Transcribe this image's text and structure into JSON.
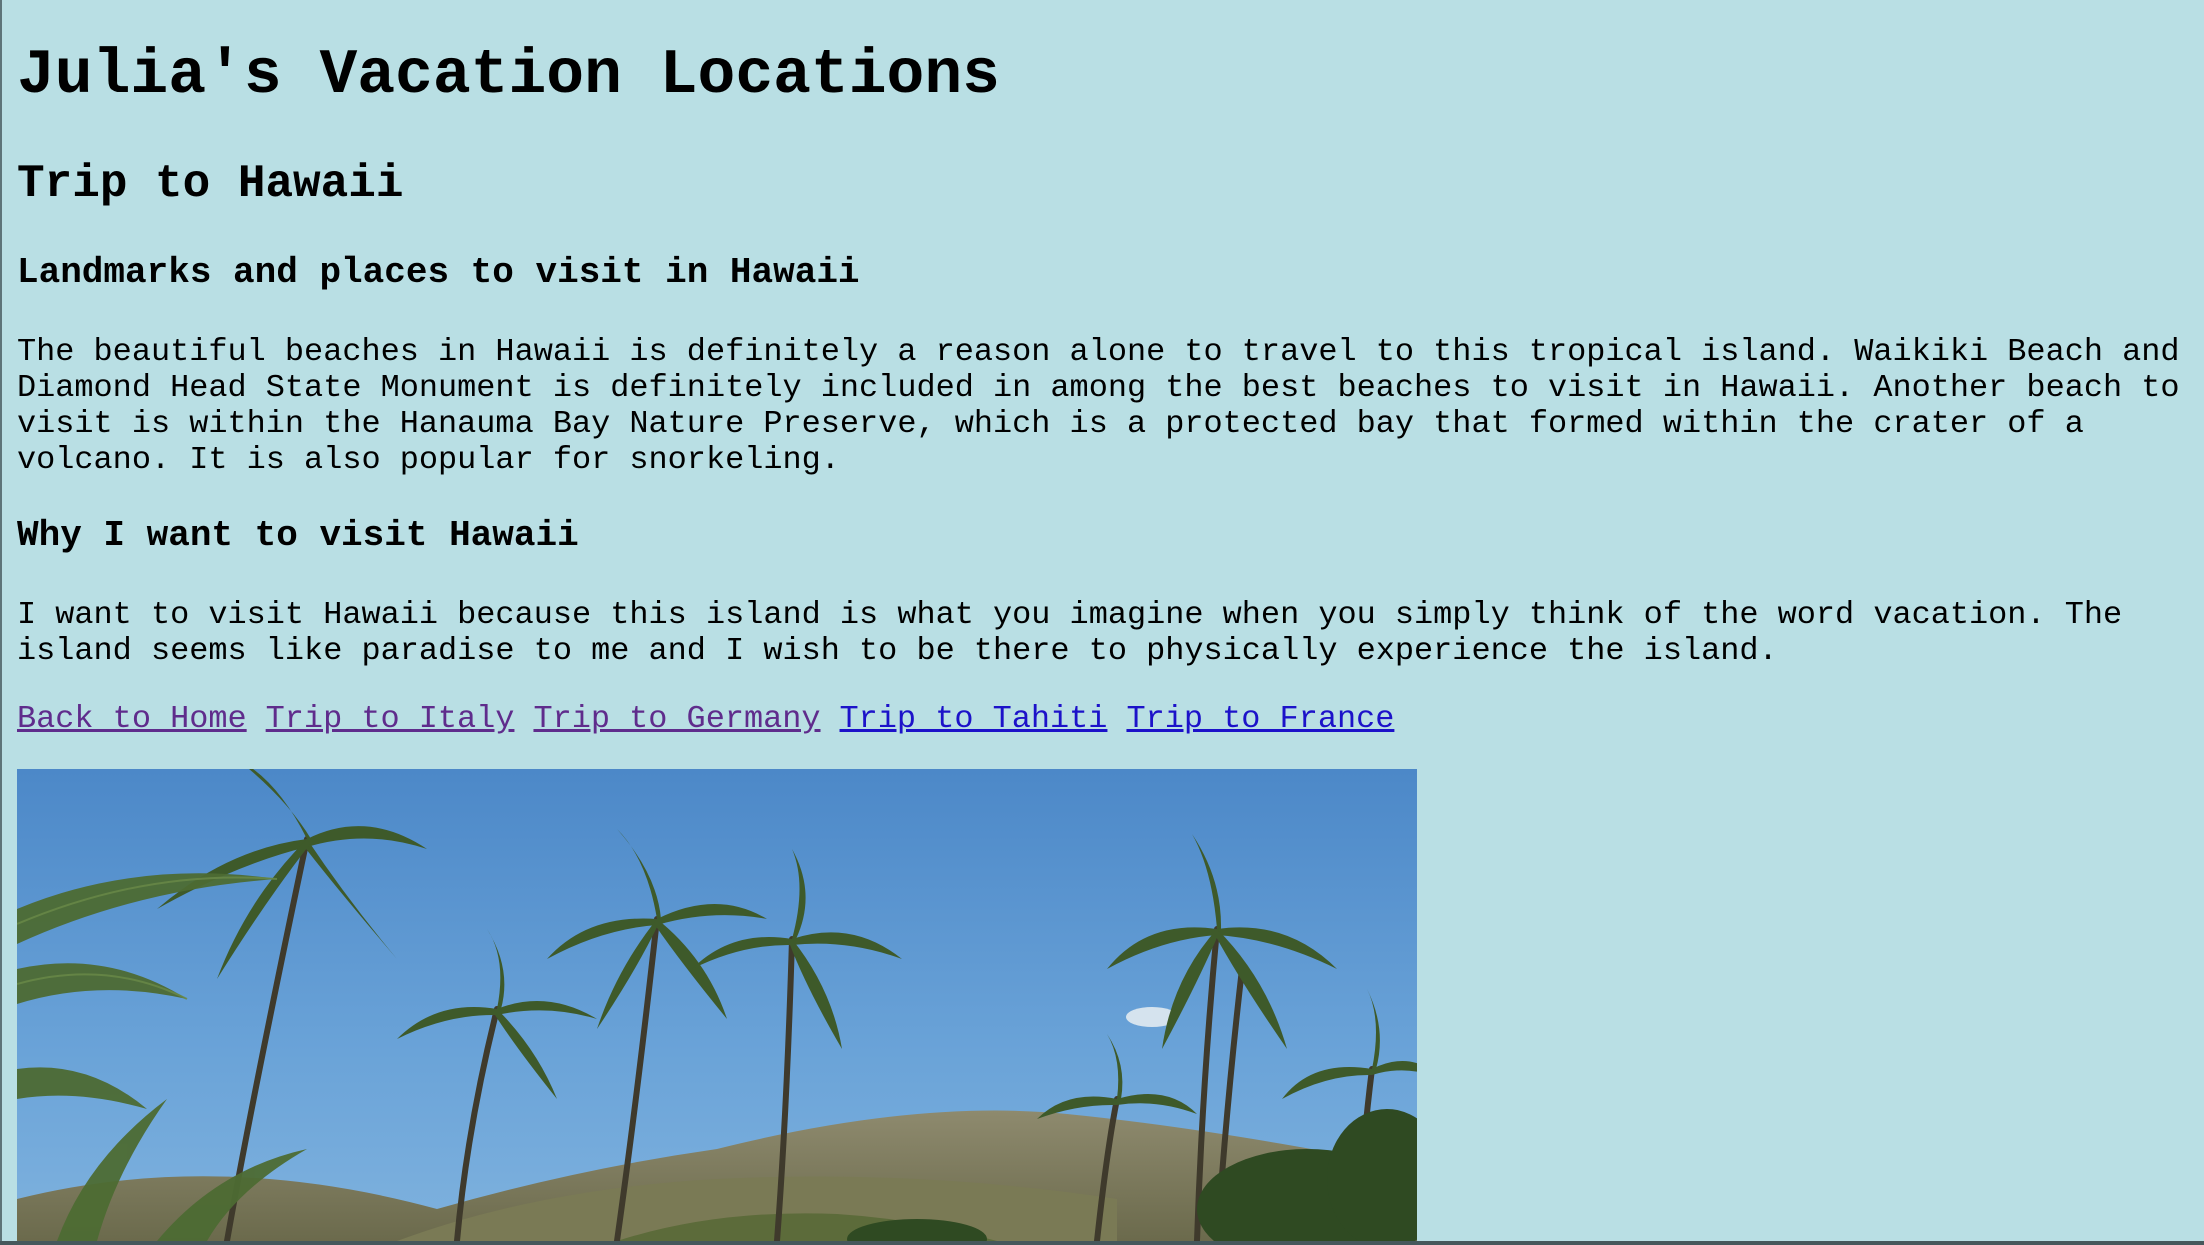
{
  "header": {
    "title": "Julia's Vacation Locations"
  },
  "main": {
    "trip_title": "Trip to Hawaii",
    "sections": [
      {
        "heading": "Landmarks and places to visit in Hawaii",
        "body": "The beautiful beaches in Hawaii is definitely a reason alone to travel to this tropical island. Waikiki Beach and Diamond Head State Monument is definitely included in among the best beaches to visit in Hawaii. Another beach to visit is within the Hanauma Bay Nature Preserve, which is a protected bay that formed within the crater of a volcano. It is also popular for snorkeling."
      },
      {
        "heading": "Why I want to visit Hawaii",
        "body": "I want to visit Hawaii because this island is what you imagine when you simply think of the word vacation. The island seems like paradise to me and I wish to be there to physically experience the island."
      }
    ],
    "nav_links": [
      {
        "label": "Back to Home",
        "visited": true
      },
      {
        "label": "Trip to Italy",
        "visited": true
      },
      {
        "label": "Trip to Germany",
        "visited": true
      },
      {
        "label": "Trip to Tahiti",
        "visited": false
      },
      {
        "label": "Trip to France",
        "visited": false
      }
    ],
    "photo": {
      "subject": "palm-trees-photo"
    }
  },
  "colors": {
    "background": "#b9dfe4",
    "link": "#1c12c9",
    "link_visited": "#5f2c8c",
    "sky": "#5f9ad2"
  }
}
